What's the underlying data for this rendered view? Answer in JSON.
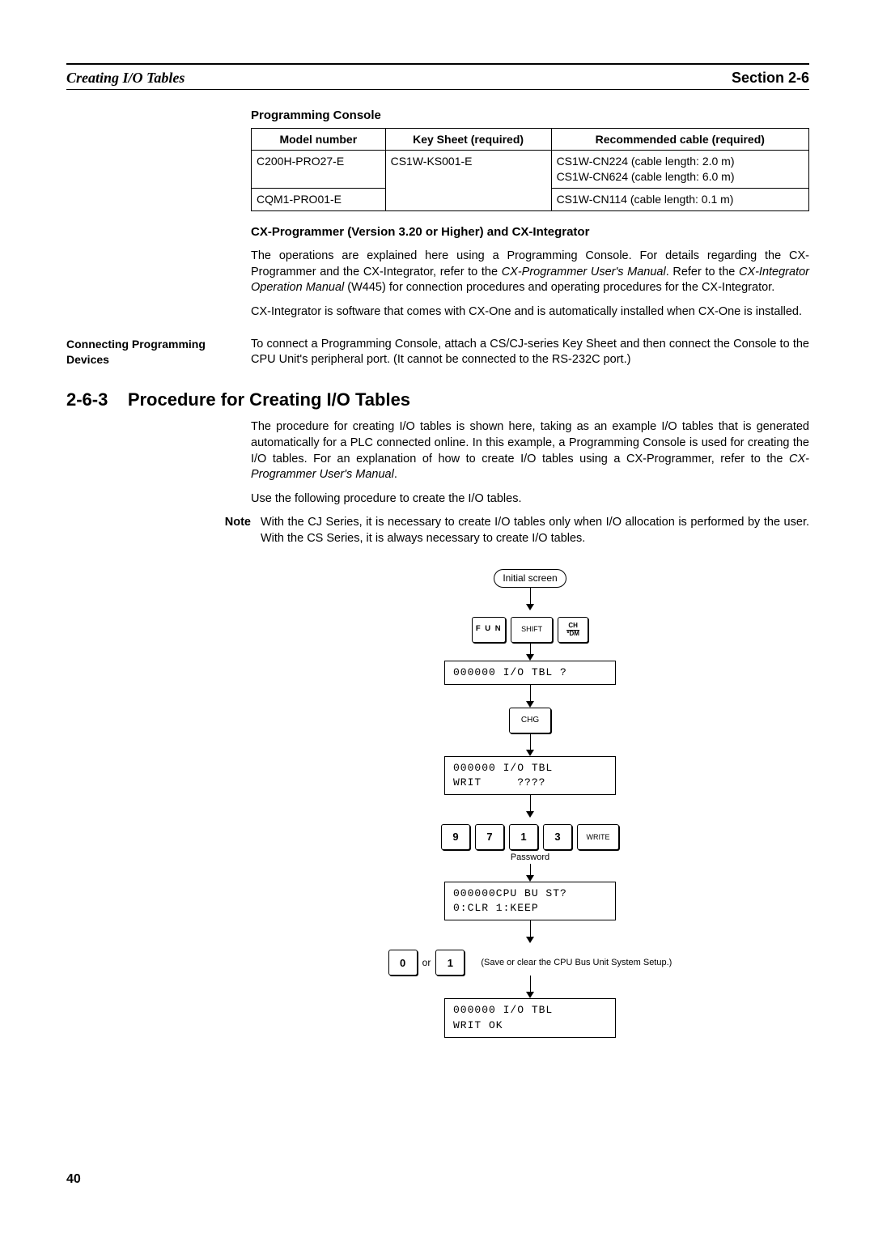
{
  "header": {
    "title_left": "Creating I/O Tables",
    "title_right": "Section 2-6"
  },
  "table": {
    "caption": "Programming Console",
    "headers": [
      "Model number",
      "Key Sheet (required)",
      "Recommended cable (required)"
    ],
    "rows": [
      {
        "model": "C200H-PRO27-E",
        "keysheet": "CS1W-KS001-E",
        "cable_lines": [
          "CS1W-CN224 (cable length: 2.0 m)",
          "CS1W-CN624 (cable length: 6.0 m)"
        ]
      },
      {
        "model": "CQM1-PRO01-E",
        "keysheet": "",
        "cable_lines": [
          "CS1W-CN114 (cable length: 0.1 m)"
        ]
      }
    ]
  },
  "cxprog": {
    "heading": "CX-Programmer (Version 3.20 or Higher) and CX-Integrator",
    "para1_a": "The operations are explained here using a Programming Console. For details regarding the CX-Programmer and the CX-Integrator, refer to the ",
    "para1_em1": "CX-Programmer User's Manual",
    "para1_b": ". Refer to the ",
    "para1_em2": "CX-Integrator Operation Manual",
    "para1_c": " (W445) for connection procedures and operating procedures for the CX-Integrator.",
    "para2": "CX-Integrator is software that comes with CX-One and is automatically installed when CX-One is installed."
  },
  "connect": {
    "side_label": "Connecting Programming Devices",
    "text": "To connect a Programming Console, attach a CS/CJ-series Key Sheet and then connect the Console to the CPU Unit's peripheral port. (It cannot be connected to the RS-232C port.)"
  },
  "section263": {
    "number": "2-6-3",
    "title": "Procedure for Creating I/O Tables",
    "para1_a": "The procedure for creating I/O tables is shown here, taking as an example I/O tables that is generated automatically for a PLC connected online. In this example, a Programming Console is used for creating the I/O tables. For an explanation of how to create I/O tables using a CX-Programmer, refer to the ",
    "para1_em": "CX-Programmer User's Manual",
    "para1_b": ".",
    "para2": "Use the following procedure to create the I/O tables.",
    "note_label": "Note",
    "note_text": "With the CJ Series, it is necessary to create I/O tables only when I/O allocation is performed by the user. With the CS Series, it is always necessary to create I/O tables."
  },
  "flowchart": {
    "initial": "Initial screen",
    "keys1": {
      "fun": "F U N",
      "shift": "SHIFT",
      "ch_top": "CH",
      "ch_bot": "*DM"
    },
    "lcd1": "000000 I/O TBL ?",
    "chg": "CHG",
    "lcd2_l1": "000000 I/O TBL",
    "lcd2_l2": "WRIT     ????",
    "digits": [
      "9",
      "7",
      "1",
      "3"
    ],
    "write": "WRITE",
    "password_label": "Password",
    "lcd3_l1": "000000CPU BU ST?",
    "lcd3_l2": "0:CLR 1:KEEP",
    "zero": "0",
    "or": "or",
    "one": "1",
    "annot": "(Save or clear the CPU Bus Unit System Setup.)",
    "lcd4_l1": "000000 I/O TBL",
    "lcd4_l2": "WRIT OK"
  },
  "page_number": "40"
}
